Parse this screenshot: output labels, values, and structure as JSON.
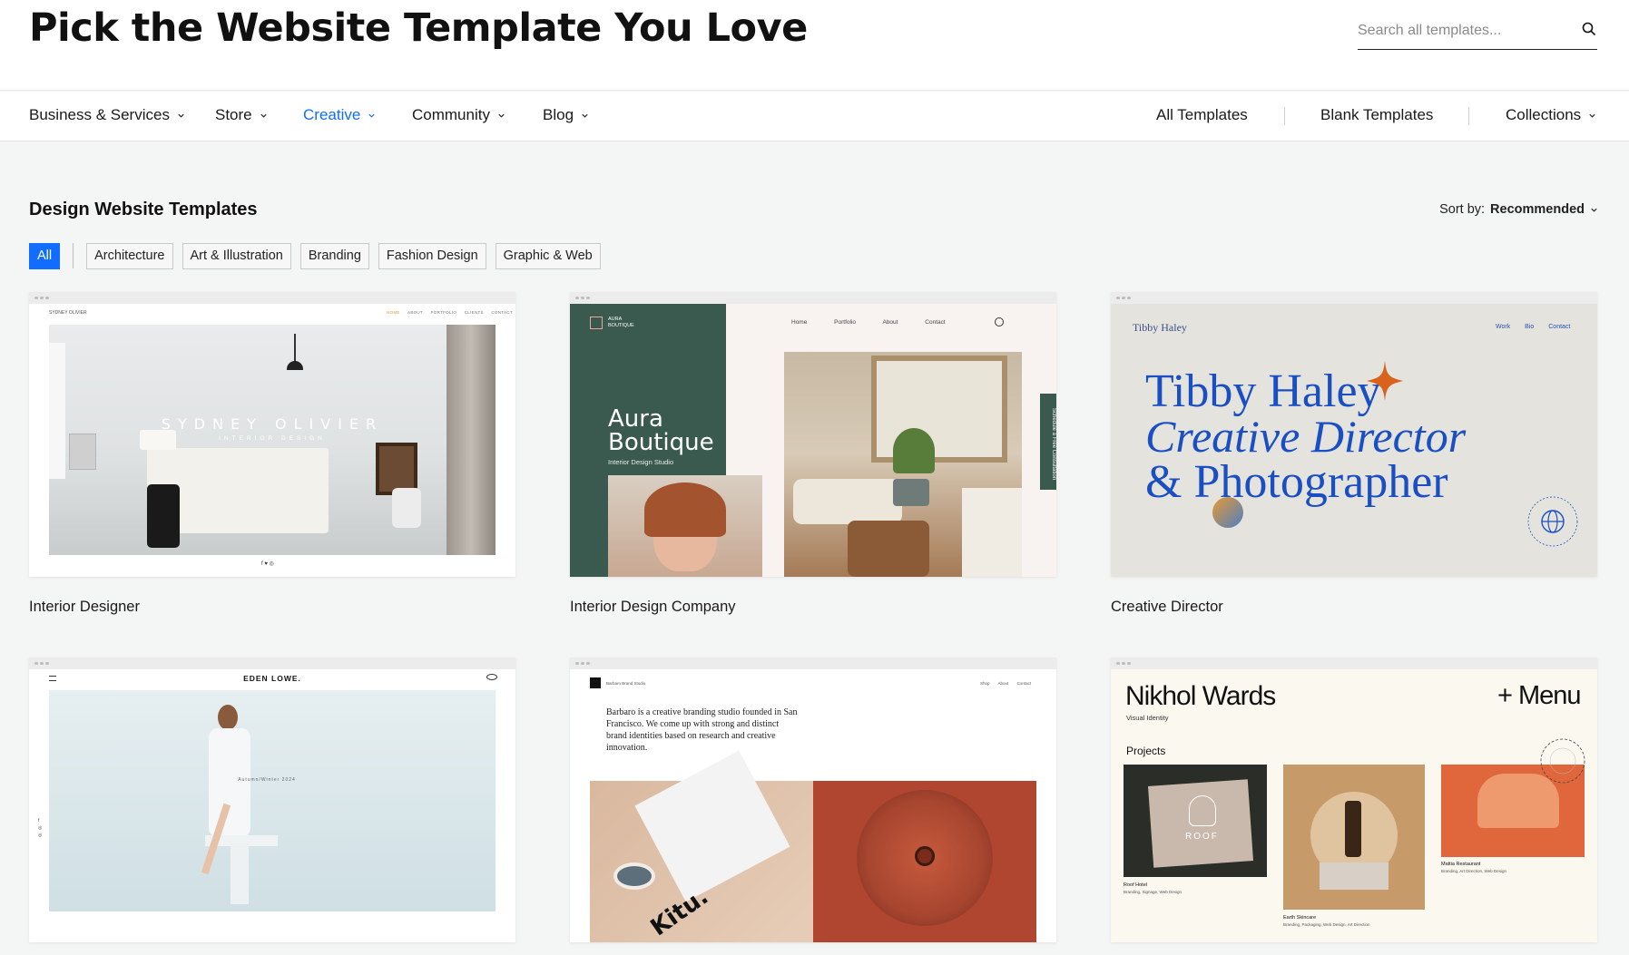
{
  "header": {
    "title": "Pick the Website Template You Love",
    "search_placeholder": "Search all templates..."
  },
  "nav": {
    "left": [
      {
        "label": "Business & Services",
        "active": false
      },
      {
        "label": "Store",
        "active": false
      },
      {
        "label": "Creative",
        "active": true
      },
      {
        "label": "Community",
        "active": false
      },
      {
        "label": "Blog",
        "active": false
      }
    ],
    "right": [
      "All Templates",
      "Blank Templates",
      "Collections"
    ]
  },
  "section": {
    "title": "Design Website Templates",
    "sort_label": "Sort by:",
    "sort_value": "Recommended"
  },
  "filters": [
    "All",
    "Architecture",
    "Art & Illustration",
    "Branding",
    "Fashion Design",
    "Graphic & Web"
  ],
  "templates": [
    {
      "caption": "Interior Designer",
      "brand": "SYDNEY OLIVIER",
      "heading": "SYDNEY OLIVIER",
      "sub": "INTERIOR DESIGN",
      "menu": [
        "HOME",
        "ABOUT",
        "PORTFOLIO",
        "CLIENTS",
        "CONTACT"
      ]
    },
    {
      "caption": "Interior Design Company",
      "brand": "AURA BOUTIQUE",
      "heading_1": "Aura",
      "heading_2": "Boutique",
      "sub": "Interior Design Studio",
      "menu": [
        "Home",
        "Portfolio",
        "About",
        "Contact"
      ],
      "side_tab": "Schedule a Free Consultation"
    },
    {
      "caption": "Creative Director",
      "brand": "Tibby Haley",
      "line_1": "Tibby Haley",
      "line_2": "Creative Director",
      "line_3": "& Photographer",
      "menu": [
        "Work",
        "Bio",
        "Contact"
      ]
    },
    {
      "caption": "",
      "brand": "EDEN LOWE.",
      "season": "Autumn/Winter 2024"
    },
    {
      "caption": "",
      "brand": "Barbaro Brand Studio",
      "menu": [
        "Shop",
        "About",
        "Contact"
      ],
      "intro": "Barbaro is a creative branding studio founded in San Francisco. We come up with strong and distinct brand identities based on research and creative innovation.",
      "product": "Kitu."
    },
    {
      "caption": "",
      "brand": "Nikhol Wards",
      "tagline": "Visual Identity",
      "menu_label": "+ Menu",
      "section": "Projects",
      "projects": [
        {
          "name": "Roof Hotel",
          "tags": "Branding, Signage, Web Design"
        },
        {
          "name": "Earth Skincare",
          "tags": "Branding, Packaging, Web Design, Art Direction"
        },
        {
          "name": "Mattia Restaurant",
          "tags": "Branding, Art Direction, Web Design"
        }
      ],
      "logo_text": "ROOF"
    }
  ],
  "colors": {
    "accent": "#116dff",
    "aura_green": "#3b5a4f",
    "tibby_blue": "#1a4fc4"
  }
}
